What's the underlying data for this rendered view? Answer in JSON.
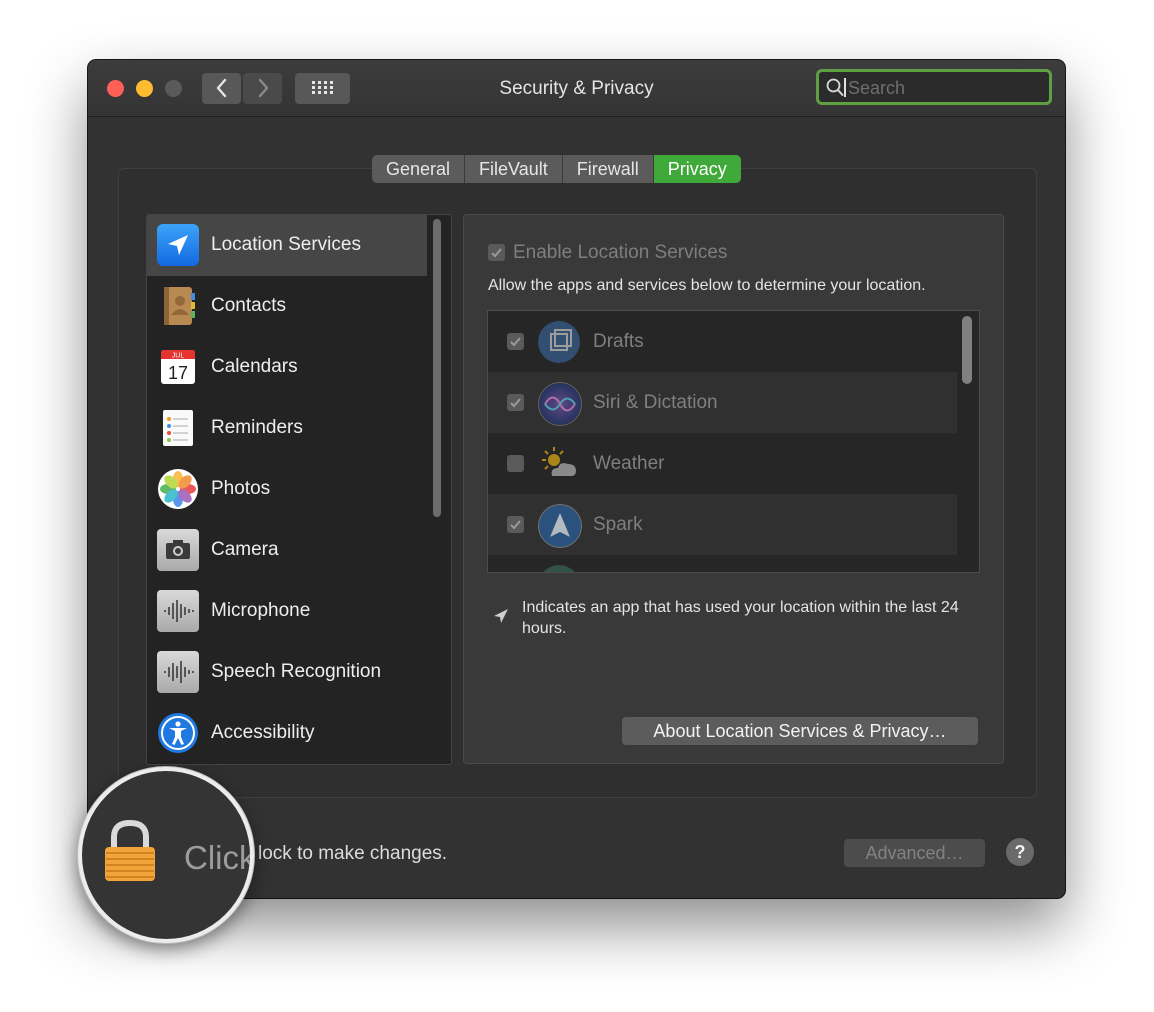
{
  "window": {
    "title": "Security & Privacy",
    "traffic_lights": [
      "#fe5f57",
      "#febc2e",
      "#5a5a5a"
    ],
    "nav": {
      "back_icon": "chevron-left-icon",
      "forward_icon": "chevron-right-icon",
      "grid_icon": "grid-icon"
    },
    "search": {
      "placeholder": "Search",
      "value": ""
    }
  },
  "tabs": [
    {
      "label": "General",
      "active": false
    },
    {
      "label": "FileVault",
      "active": false
    },
    {
      "label": "Firewall",
      "active": false
    },
    {
      "label": "Privacy",
      "active": true
    }
  ],
  "sidebar": {
    "items": [
      {
        "label": "Location Services",
        "icon": "location-arrow-icon",
        "selected": true
      },
      {
        "label": "Contacts",
        "icon": "contacts-book-icon",
        "selected": false
      },
      {
        "label": "Calendars",
        "icon": "calendar-icon",
        "selected": false,
        "icon_month": "JUL",
        "icon_day": "17"
      },
      {
        "label": "Reminders",
        "icon": "reminders-list-icon",
        "selected": false
      },
      {
        "label": "Photos",
        "icon": "photos-flower-icon",
        "selected": false
      },
      {
        "label": "Camera",
        "icon": "camera-icon",
        "selected": false
      },
      {
        "label": "Microphone",
        "icon": "microphone-waveform-icon",
        "selected": false
      },
      {
        "label": "Speech Recognition",
        "icon": "speech-waveform-icon",
        "selected": false
      },
      {
        "label": "Accessibility",
        "icon": "accessibility-person-icon",
        "selected": false
      }
    ]
  },
  "location": {
    "enable_label": "Enable Location Services",
    "enable_checked": true,
    "description": "Allow the apps and services below to determine your location.",
    "apps": [
      {
        "name": "Drafts",
        "checked": true,
        "icon": "drafts-app-icon"
      },
      {
        "name": "Siri & Dictation",
        "checked": true,
        "icon": "siri-icon"
      },
      {
        "name": "Weather",
        "checked": false,
        "icon": "weather-sun-cloud-icon"
      },
      {
        "name": "Spark",
        "checked": true,
        "icon": "spark-app-icon"
      }
    ],
    "note": "Indicates an app that has used your location within the last 24 hours.",
    "about_button": "About Location Services & Privacy…"
  },
  "footer": {
    "lock_text": "lock to make changes.",
    "magnified_text": "Click",
    "advanced_button": "Advanced…",
    "help_button": "?"
  },
  "colors": {
    "accent_green": "#3fa93a",
    "search_focus_ring": "#5fa043",
    "window_bg": "#323232"
  }
}
